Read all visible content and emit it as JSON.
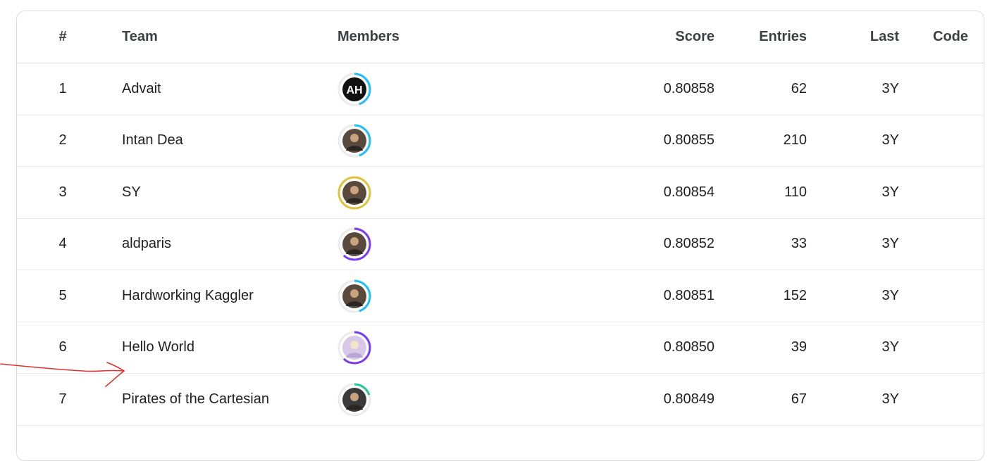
{
  "columns": {
    "rank": "#",
    "team": "Team",
    "members": "Members",
    "score": "Score",
    "entries": "Entries",
    "last": "Last",
    "code": "Code"
  },
  "rows": [
    {
      "rank": "1",
      "team": "Advait",
      "score": "0.80858",
      "entries": "62",
      "last": "3Y",
      "avatar": {
        "ring_color": "#20beff",
        "ring_fraction": 0.45,
        "icon": "AH-logo-avatar"
      }
    },
    {
      "rank": "2",
      "team": "Intan Dea",
      "score": "0.80855",
      "entries": "210",
      "last": "3Y",
      "avatar": {
        "ring_color": "#20beff",
        "ring_fraction": 0.45,
        "icon": "person-photo-avatar"
      }
    },
    {
      "rank": "3",
      "team": "SY",
      "score": "0.80854",
      "entries": "110",
      "last": "3Y",
      "avatar": {
        "ring_color": "#e0c33c",
        "ring_fraction": 1.0,
        "icon": "person-photo-avatar"
      }
    },
    {
      "rank": "4",
      "team": "aldparis",
      "score": "0.80852",
      "entries": "33",
      "last": "3Y",
      "avatar": {
        "ring_color": "#7b3bf0",
        "ring_fraction": 0.62,
        "icon": "person-photo-avatar"
      }
    },
    {
      "rank": "5",
      "team": "Hardworking Kaggler",
      "score": "0.80851",
      "entries": "152",
      "last": "3Y",
      "avatar": {
        "ring_color": "#20beff",
        "ring_fraction": 0.45,
        "icon": "person-photo-avatar"
      }
    },
    {
      "rank": "6",
      "team": "Hello World",
      "score": "0.80850",
      "entries": "39",
      "last": "3Y",
      "avatar": {
        "ring_color": "#7b3bf0",
        "ring_fraction": 0.62,
        "icon": "anime-avatar"
      }
    },
    {
      "rank": "7",
      "team": "Pirates of the Cartesian",
      "score": "0.80849",
      "entries": "67",
      "last": "3Y",
      "avatar": {
        "ring_color": "#20c997",
        "ring_fraction": 0.2,
        "icon": "pirate-avatar"
      }
    }
  ],
  "annotation": {
    "color": "#e03030",
    "icon": "hand-drawn-arrow"
  }
}
